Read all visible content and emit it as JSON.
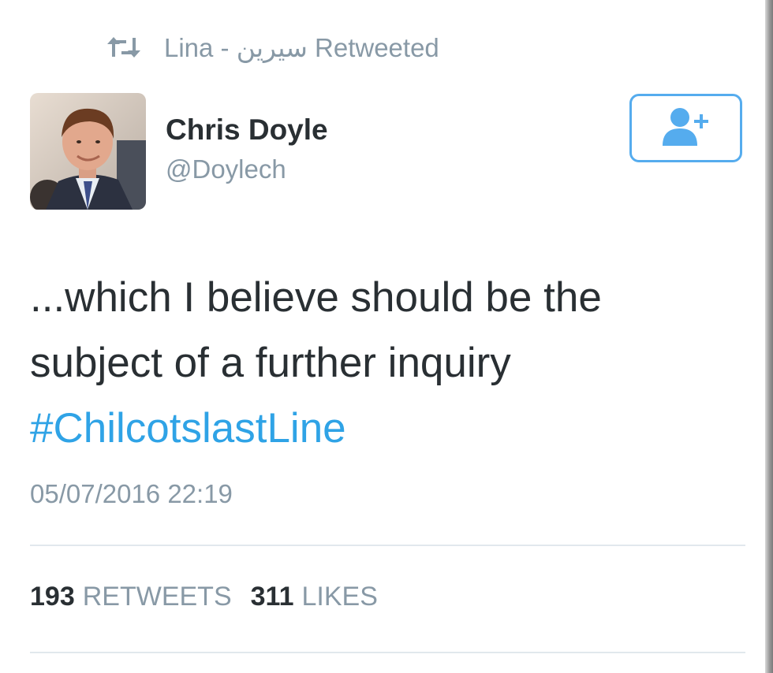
{
  "retweet_context": {
    "icon": "retweet-icon",
    "text": "Lina - سيرين Retweeted"
  },
  "author": {
    "name": "Chris Doyle",
    "handle": "@Doylech",
    "avatar": "author-avatar"
  },
  "follow_button": {
    "icon": "follow-user-icon"
  },
  "tweet": {
    "line1": "...which I believe should be the",
    "line2": "subject of a further inquiry",
    "hashtag": "#ChilcotslastLine"
  },
  "timestamp": "05/07/2016 22:19",
  "stats": {
    "retweets_count": "193",
    "retweets_label": "RETWEETS",
    "likes_count": "311",
    "likes_label": "LIKES"
  },
  "colors": {
    "accent": "#55acee",
    "hashtag": "#2fa3e6",
    "muted": "#8899a6",
    "text": "#292f33",
    "divider": "#e1e8ed"
  }
}
